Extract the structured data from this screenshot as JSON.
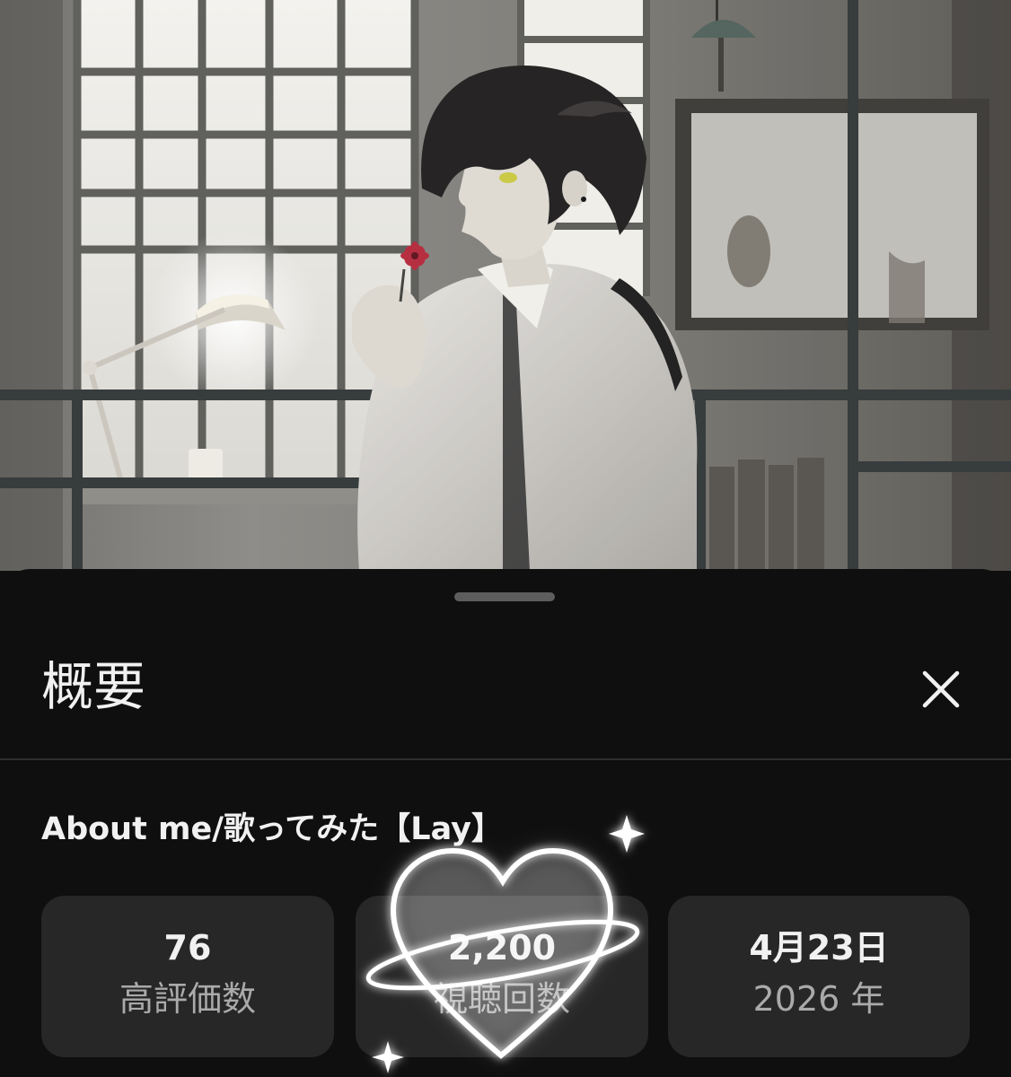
{
  "thumbnail": {
    "alt": "Illustration of a dark-haired young man holding a red flower behind a gridded window"
  },
  "sheet": {
    "title": "概要",
    "close_icon": "close-icon"
  },
  "video": {
    "title": "About me/歌ってみた【Lay】"
  },
  "stats": [
    {
      "value": "76",
      "label": "高評価数"
    },
    {
      "value": "2,200",
      "label": "視聴回数"
    },
    {
      "value": "4月23日",
      "label": "2026 年"
    }
  ],
  "colors": {
    "background": "#0f0f0f",
    "card": "#272727",
    "text_primary": "#f1f1f1",
    "text_secondary": "#aaaaaa",
    "flower": "#b3273a",
    "eye": "#c8c840"
  }
}
